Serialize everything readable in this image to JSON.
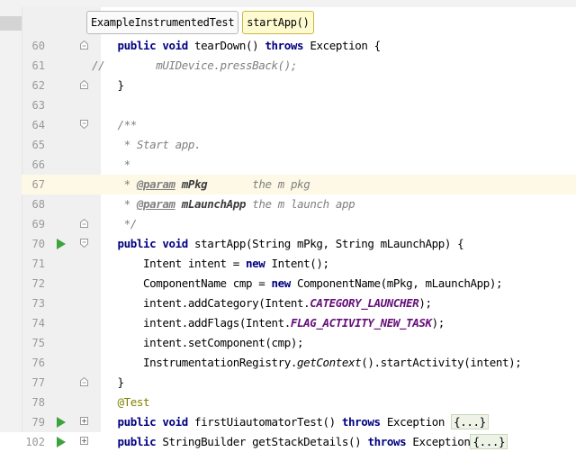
{
  "breadcrumbs": [
    {
      "label": "ExampleInstrumentedTest",
      "active": false
    },
    {
      "label": "startApp()",
      "active": true
    }
  ],
  "lines": [
    {
      "num": "60",
      "run": false,
      "fold": "end",
      "parts": [
        {
          "t": "    "
        },
        {
          "t": "public void",
          "c": "kw"
        },
        {
          "t": " tearDown() "
        },
        {
          "t": "throws",
          "c": "kw"
        },
        {
          "t": " Exception {"
        }
      ]
    },
    {
      "num": "61",
      "run": false,
      "fold": "",
      "parts": [
        {
          "t": "//        mUIDevice.pressBack();",
          "c": "cm"
        }
      ]
    },
    {
      "num": "62",
      "run": false,
      "fold": "end",
      "parts": [
        {
          "t": "    }"
        }
      ]
    },
    {
      "num": "63",
      "run": false,
      "fold": "",
      "parts": [
        {
          "t": ""
        }
      ]
    },
    {
      "num": "64",
      "run": false,
      "fold": "start",
      "parts": [
        {
          "t": "    "
        },
        {
          "t": "/**",
          "c": "cm"
        }
      ]
    },
    {
      "num": "65",
      "run": false,
      "fold": "",
      "parts": [
        {
          "t": "     * Start app.",
          "c": "cm"
        }
      ]
    },
    {
      "num": "66",
      "run": false,
      "fold": "",
      "parts": [
        {
          "t": "     *",
          "c": "cm"
        }
      ]
    },
    {
      "num": "67",
      "run": false,
      "fold": "",
      "current": true,
      "parts": [
        {
          "t": "     * ",
          "c": "cm"
        },
        {
          "t": "@param",
          "c": "dt"
        },
        {
          "t": " "
        },
        {
          "t": "mPkg",
          "c": "pn"
        },
        {
          "t": "       the m pkg",
          "c": "cm"
        }
      ]
    },
    {
      "num": "68",
      "run": false,
      "fold": "",
      "parts": [
        {
          "t": "     * ",
          "c": "cm"
        },
        {
          "t": "@param",
          "c": "dt"
        },
        {
          "t": " "
        },
        {
          "t": "mLaunchApp",
          "c": "pn"
        },
        {
          "t": " the m launch app",
          "c": "cm"
        }
      ]
    },
    {
      "num": "69",
      "run": false,
      "fold": "end",
      "parts": [
        {
          "t": "     */",
          "c": "cm"
        }
      ]
    },
    {
      "num": "70",
      "run": true,
      "fold": "start",
      "parts": [
        {
          "t": "    "
        },
        {
          "t": "public void",
          "c": "kw"
        },
        {
          "t": " startApp(String mPkg, String mLaunchApp) {"
        }
      ]
    },
    {
      "num": "71",
      "run": false,
      "fold": "",
      "parts": [
        {
          "t": "        Intent intent = "
        },
        {
          "t": "new",
          "c": "kw"
        },
        {
          "t": " Intent();"
        }
      ]
    },
    {
      "num": "72",
      "run": false,
      "fold": "",
      "parts": [
        {
          "t": "        ComponentName cmp = "
        },
        {
          "t": "new",
          "c": "kw"
        },
        {
          "t": " ComponentName(mPkg, mLaunchApp);"
        }
      ]
    },
    {
      "num": "73",
      "run": false,
      "fold": "",
      "parts": [
        {
          "t": "        intent.addCategory(Intent."
        },
        {
          "t": "CATEGORY_LAUNCHER",
          "c": "st"
        },
        {
          "t": ");"
        }
      ]
    },
    {
      "num": "74",
      "run": false,
      "fold": "",
      "parts": [
        {
          "t": "        intent.addFlags(Intent."
        },
        {
          "t": "FLAG_ACTIVITY_NEW_TASK",
          "c": "st"
        },
        {
          "t": ");"
        }
      ]
    },
    {
      "num": "75",
      "run": false,
      "fold": "",
      "parts": [
        {
          "t": "        intent.setComponent(cmp);"
        }
      ]
    },
    {
      "num": "76",
      "run": false,
      "fold": "",
      "parts": [
        {
          "t": "        InstrumentationRegistry."
        },
        {
          "t": "getContext",
          "c": "it"
        },
        {
          "t": "().startActivity(intent);"
        }
      ]
    },
    {
      "num": "77",
      "run": false,
      "fold": "end",
      "parts": [
        {
          "t": "    }"
        }
      ]
    },
    {
      "num": "78",
      "run": false,
      "fold": "",
      "parts": [
        {
          "t": "    "
        },
        {
          "t": "@Test",
          "c": "an"
        }
      ]
    },
    {
      "num": "79",
      "run": true,
      "fold": "plus",
      "parts": [
        {
          "t": "    "
        },
        {
          "t": "public void",
          "c": "kw"
        },
        {
          "t": " firstUiautomatorTest() "
        },
        {
          "t": "throws",
          "c": "kw"
        },
        {
          "t": " Exception "
        },
        {
          "t": "{...}",
          "c": "fb"
        }
      ]
    },
    {
      "num": "102",
      "run": true,
      "fold": "plus",
      "parts": [
        {
          "t": "    "
        },
        {
          "t": "public",
          "c": "kw"
        },
        {
          "t": " StringBuilder getStackDetails() "
        },
        {
          "t": "throws",
          "c": "kw"
        },
        {
          "t": " Exception"
        },
        {
          "t": "{...}",
          "c": "fb"
        }
      ]
    }
  ]
}
